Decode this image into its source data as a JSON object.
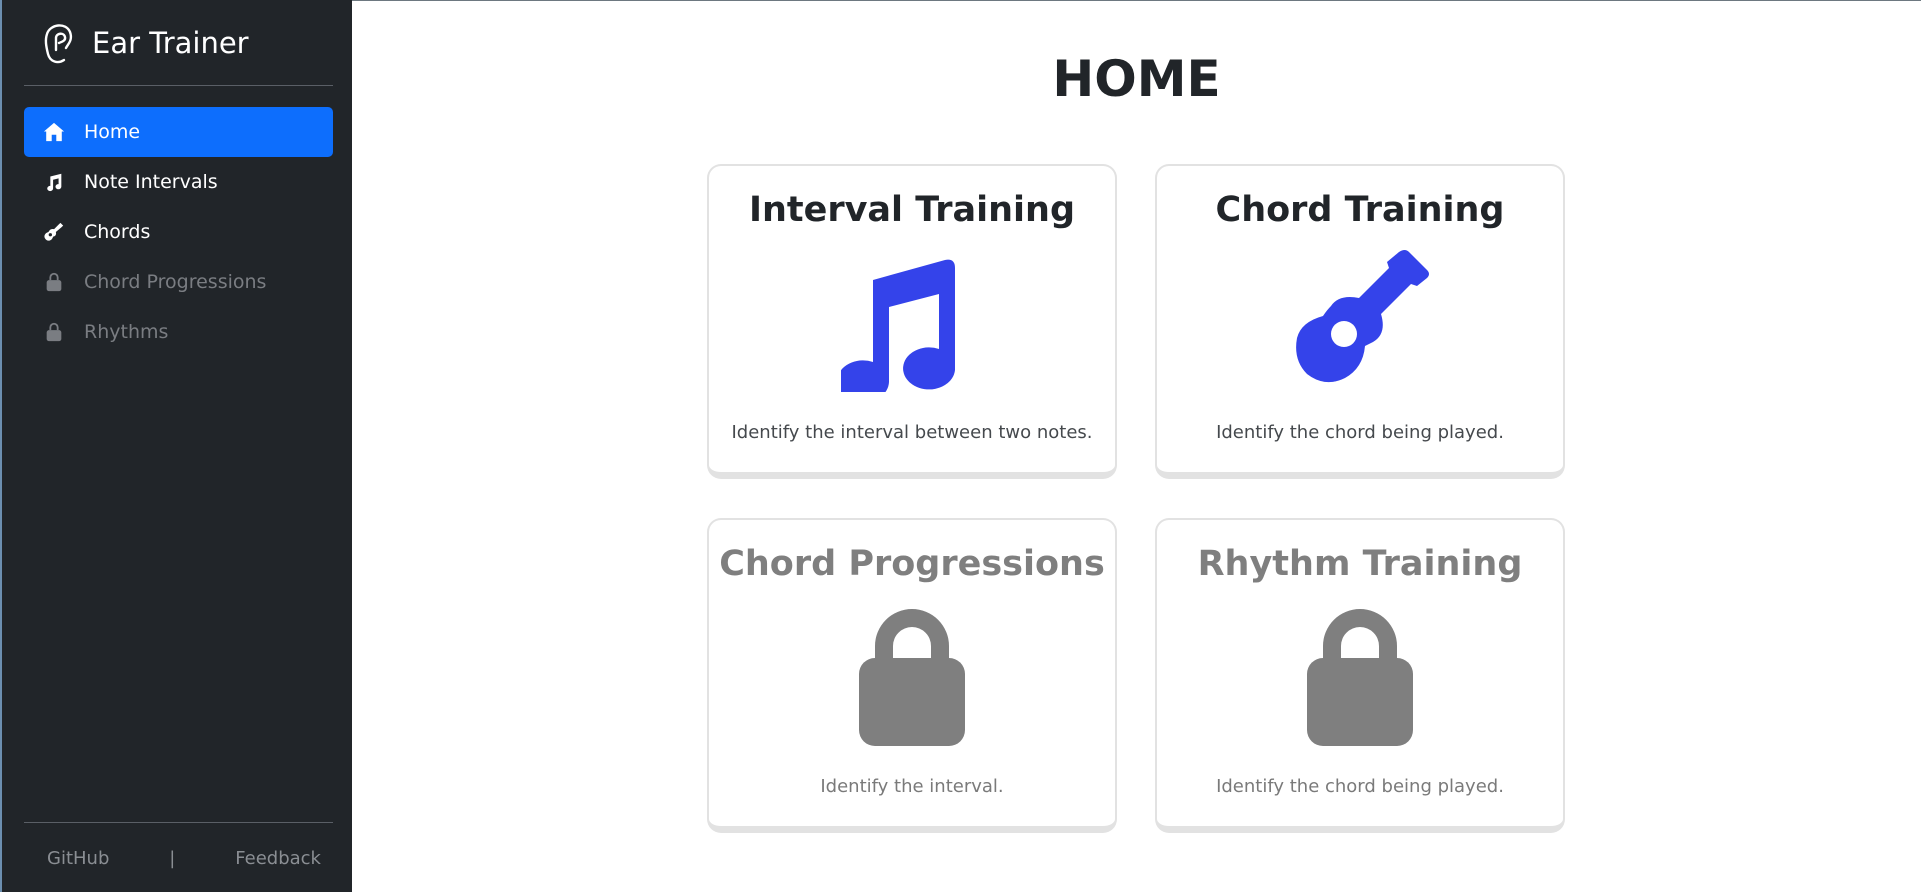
{
  "app": {
    "title": "Ear Trainer"
  },
  "sidebar": {
    "items": [
      {
        "label": "Home",
        "icon": "home-icon",
        "active": true,
        "locked": false
      },
      {
        "label": "Note Intervals",
        "icon": "music-note-icon",
        "active": false,
        "locked": false
      },
      {
        "label": "Chords",
        "icon": "guitar-icon",
        "active": false,
        "locked": false
      },
      {
        "label": "Chord Progressions",
        "icon": "lock-icon",
        "active": false,
        "locked": true
      },
      {
        "label": "Rhythms",
        "icon": "lock-icon",
        "active": false,
        "locked": true
      }
    ],
    "footer": {
      "github": "GitHub",
      "separator": "|",
      "feedback": "Feedback"
    }
  },
  "main": {
    "title": "HOME",
    "cards": [
      {
        "title": "Interval Training",
        "description": "Identify the interval between two notes.",
        "icon": "music-note-icon",
        "locked": false
      },
      {
        "title": "Chord Training",
        "description": "Identify the chord being played.",
        "icon": "guitar-icon",
        "locked": false
      },
      {
        "title": "Chord Progressions",
        "description": "Identify the interval.",
        "icon": "lock-icon",
        "locked": true
      },
      {
        "title": "Rhythm Training",
        "description": "Identify the chord being played.",
        "icon": "lock-icon",
        "locked": true
      }
    ]
  },
  "colors": {
    "sidebar_bg": "#212529",
    "active_accent": "#0d6efd",
    "icon_accent": "#3443ea",
    "locked_gray": "#7f7f7f"
  }
}
